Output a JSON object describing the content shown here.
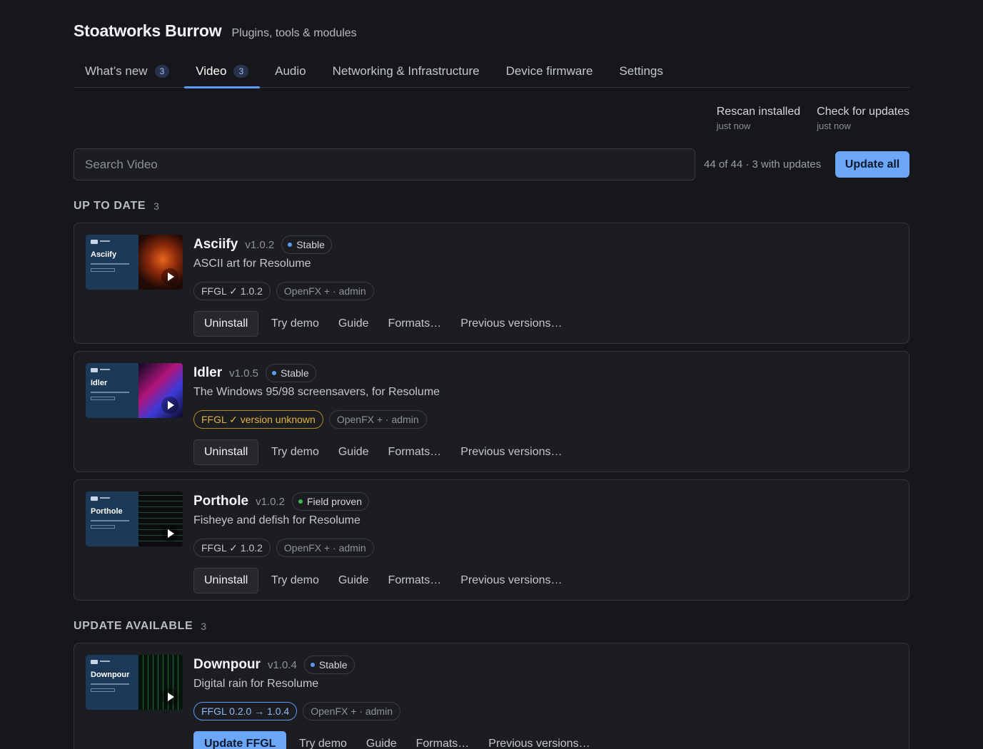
{
  "app": {
    "title": "Stoatworks Burrow",
    "subtitle": "Plugins, tools & modules"
  },
  "tabs": [
    {
      "label": "What’s new",
      "count": "3",
      "active": false
    },
    {
      "label": "Video",
      "count": "3",
      "active": true
    },
    {
      "label": "Audio",
      "count": "",
      "active": false
    },
    {
      "label": "Networking & Infrastructure",
      "count": "",
      "active": false
    },
    {
      "label": "Device firmware",
      "count": "",
      "active": false
    },
    {
      "label": "Settings",
      "count": "",
      "active": false
    }
  ],
  "actions": [
    {
      "label": "Rescan installed",
      "time": "just now"
    },
    {
      "label": "Check for updates",
      "time": "just now"
    }
  ],
  "search": {
    "placeholder": "Search Video",
    "stats": "44 of 44 · 3 with updates",
    "update_all": "Update all"
  },
  "sections": [
    {
      "title": "UP TO DATE",
      "count": "3"
    },
    {
      "title": "UPDATE AVAILABLE",
      "count": "3"
    }
  ],
  "plugins": [
    {
      "name": "Asciify",
      "version": "v1.0.2",
      "status": {
        "label": "Stable",
        "color": "#5b9bf5"
      },
      "description": "ASCII art for Resolume",
      "ffgl_tag": "FFGL ✓ 1.0.2",
      "openfx_tag": "OpenFX + · admin",
      "primary": "Uninstall",
      "links": [
        "Try demo",
        "Guide",
        "Formats…",
        "Previous versions…"
      ]
    },
    {
      "name": "Idler",
      "version": "v1.0.5",
      "status": {
        "label": "Stable",
        "color": "#5b9bf5"
      },
      "description": "The Windows 95/98 screensavers, for Resolume",
      "ffgl_tag": "FFGL ✓ version unknown",
      "openfx_tag": "OpenFX + · admin",
      "primary": "Uninstall",
      "links": [
        "Try demo",
        "Guide",
        "Formats…",
        "Previous versions…"
      ]
    },
    {
      "name": "Porthole",
      "version": "v1.0.2",
      "status": {
        "label": "Field proven",
        "color": "#3fb950"
      },
      "description": "Fisheye and defish for Resolume",
      "ffgl_tag": "FFGL ✓ 1.0.2",
      "openfx_tag": "OpenFX + · admin",
      "primary": "Uninstall",
      "links": [
        "Try demo",
        "Guide",
        "Formats…",
        "Previous versions…"
      ]
    },
    {
      "name": "Downpour",
      "version": "v1.0.4",
      "status": {
        "label": "Stable",
        "color": "#5b9bf5"
      },
      "description": "Digital rain for Resolume",
      "ffgl_tag": "FFGL 0.2.0 → 1.0.4",
      "openfx_tag": "OpenFX + · admin",
      "primary": "Update FFGL",
      "links": [
        "Try demo",
        "Guide",
        "Formats…",
        "Previous versions…"
      ]
    }
  ],
  "colors": {
    "background": "#16171a",
    "accent": "#6ba6f7",
    "warning": "#e3b341"
  }
}
